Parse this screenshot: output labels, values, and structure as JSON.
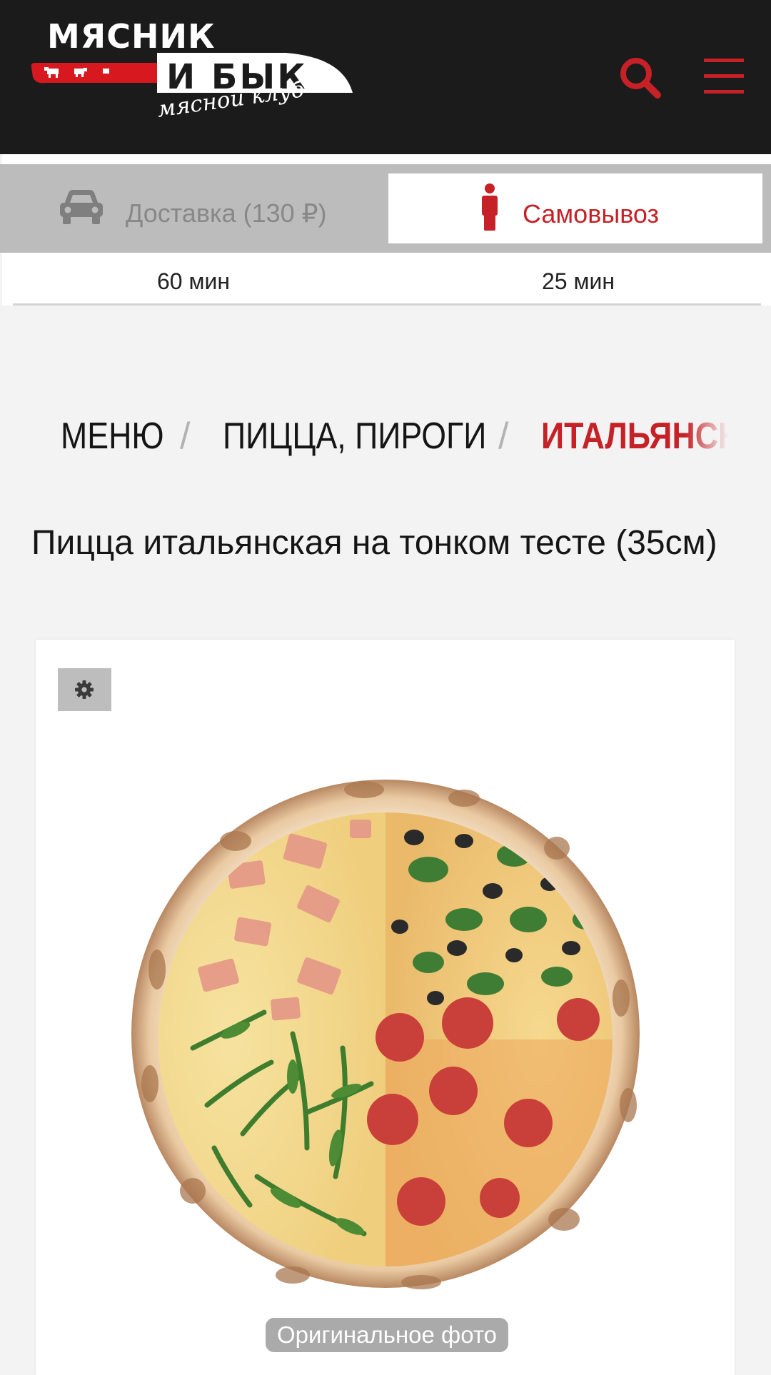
{
  "header": {
    "logo_line1": "МЯСНИК",
    "logo_line2": "И БЫК",
    "logo_sub": "мясной клуб",
    "search_icon": "search-icon",
    "menu_icon": "hamburger-icon",
    "accent_color": "#c62127",
    "background_color": "#1b1b1b"
  },
  "order_mode": {
    "delivery": {
      "label": "Доставка (130 ₽)",
      "icon": "car-icon",
      "time": "60 мин"
    },
    "pickup": {
      "label": "Самовывоз",
      "icon": "person-icon",
      "time": "25 мин",
      "selected": true
    }
  },
  "breadcrumb": {
    "items": [
      "МЕНЮ",
      "ПИЦЦА, ПИРОГИ",
      "ИТАЛЬЯНСК"
    ],
    "separator": "/"
  },
  "product": {
    "title": "Пицца итальянская на тонком тесте (35см)",
    "settings_icon": "gear-icon",
    "image": "pizza-image",
    "photo_badge": "Оригинальное фото"
  }
}
